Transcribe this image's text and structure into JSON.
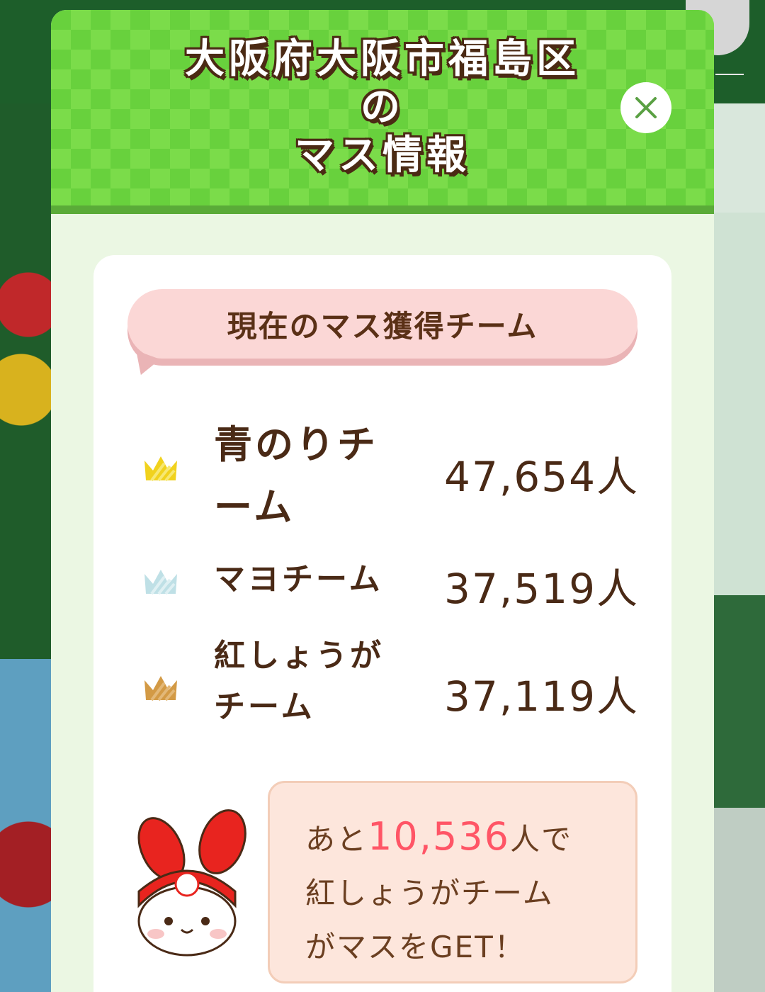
{
  "modal": {
    "title_line1": "大阪府大阪市福島区",
    "title_line2": "の",
    "title_line3": "マス情報",
    "close_label": "×"
  },
  "section": {
    "heading": "現在のマス獲得チーム"
  },
  "teams": [
    {
      "name": "青のりチーム",
      "count": "47,654人",
      "rank": 1,
      "crown_color": "#f1d21d"
    },
    {
      "name": "マヨチーム",
      "count": "37,519人",
      "rank": 2,
      "crown_color": "#bfe0e6"
    },
    {
      "name": "紅しょうがチーム",
      "count": "37,119人",
      "rank": 3,
      "crown_color": "#d39a45"
    }
  ],
  "message": {
    "prefix": "あと",
    "number": "10,536",
    "suffix": "人で",
    "line2": "紅しょうがチーム",
    "line3": "がマスをGET！"
  },
  "colors": {
    "header_green": "#68d13d",
    "modal_bg": "#ebf7e3",
    "bubble_pink": "#fbd7d6",
    "text_brown": "#4a2a16",
    "highlight_red": "#ff5566"
  }
}
